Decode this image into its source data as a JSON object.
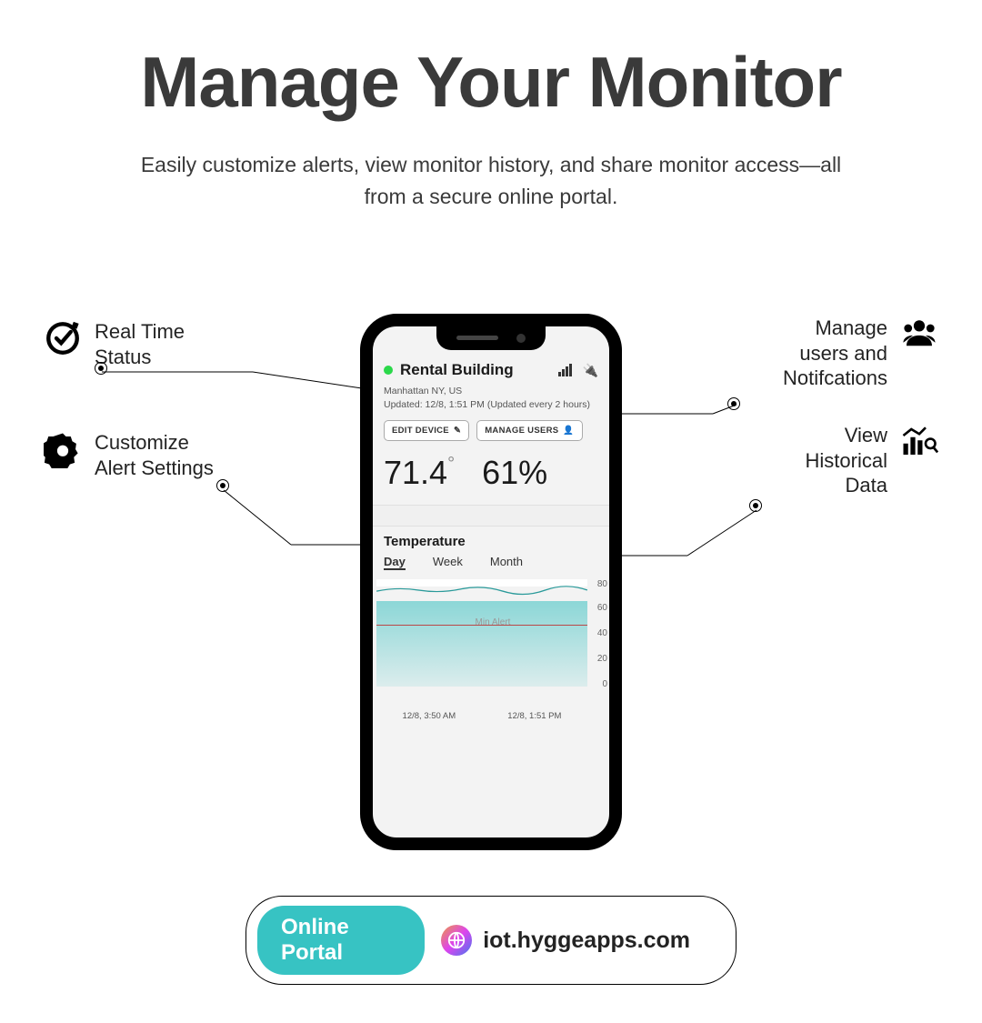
{
  "title": "Manage Your Monitor",
  "subtitle": "Easily customize alerts, view monitor history, and share monitor access—all from a secure online portal.",
  "callouts": {
    "realtime": "Real Time\nStatus",
    "customize": "Customize\nAlert Settings",
    "users": "Manage\nusers and\nNotifcations",
    "history": "View\nHistorical\nData"
  },
  "device": {
    "name": "Rental Building",
    "location": "Manhattan NY, US",
    "updated": "Updated: 12/8, 1:51 PM (Updated every 2 hours)",
    "btn_edit": "EDIT DEVICE",
    "btn_users": "MANAGE USERS",
    "temp": "71.4",
    "humidity": "61%"
  },
  "chart": {
    "title": "Temperature",
    "tabs": [
      "Day",
      "Week",
      "Month"
    ],
    "alert_label": "Min Alert",
    "yticks": [
      "80",
      "60",
      "40",
      "20",
      "0"
    ],
    "xticks": [
      "12/8, 3:50 AM",
      "12/8, 1:51 PM"
    ]
  },
  "chart_data": {
    "type": "area",
    "title": "Temperature",
    "xlabel": "",
    "ylabel": "",
    "ylim": [
      0,
      80
    ],
    "x": [
      "12/8, 3:50 AM",
      "12/8, 1:51 PM"
    ],
    "series": [
      {
        "name": "Temperature",
        "values": [
          70,
          72,
          71,
          73,
          71,
          72,
          71,
          72
        ]
      }
    ],
    "annotations": [
      {
        "type": "hline",
        "value": 48,
        "label": "Min Alert"
      }
    ]
  },
  "portal": {
    "badge": "Online Portal",
    "url": "iot.hyggeapps.com"
  }
}
